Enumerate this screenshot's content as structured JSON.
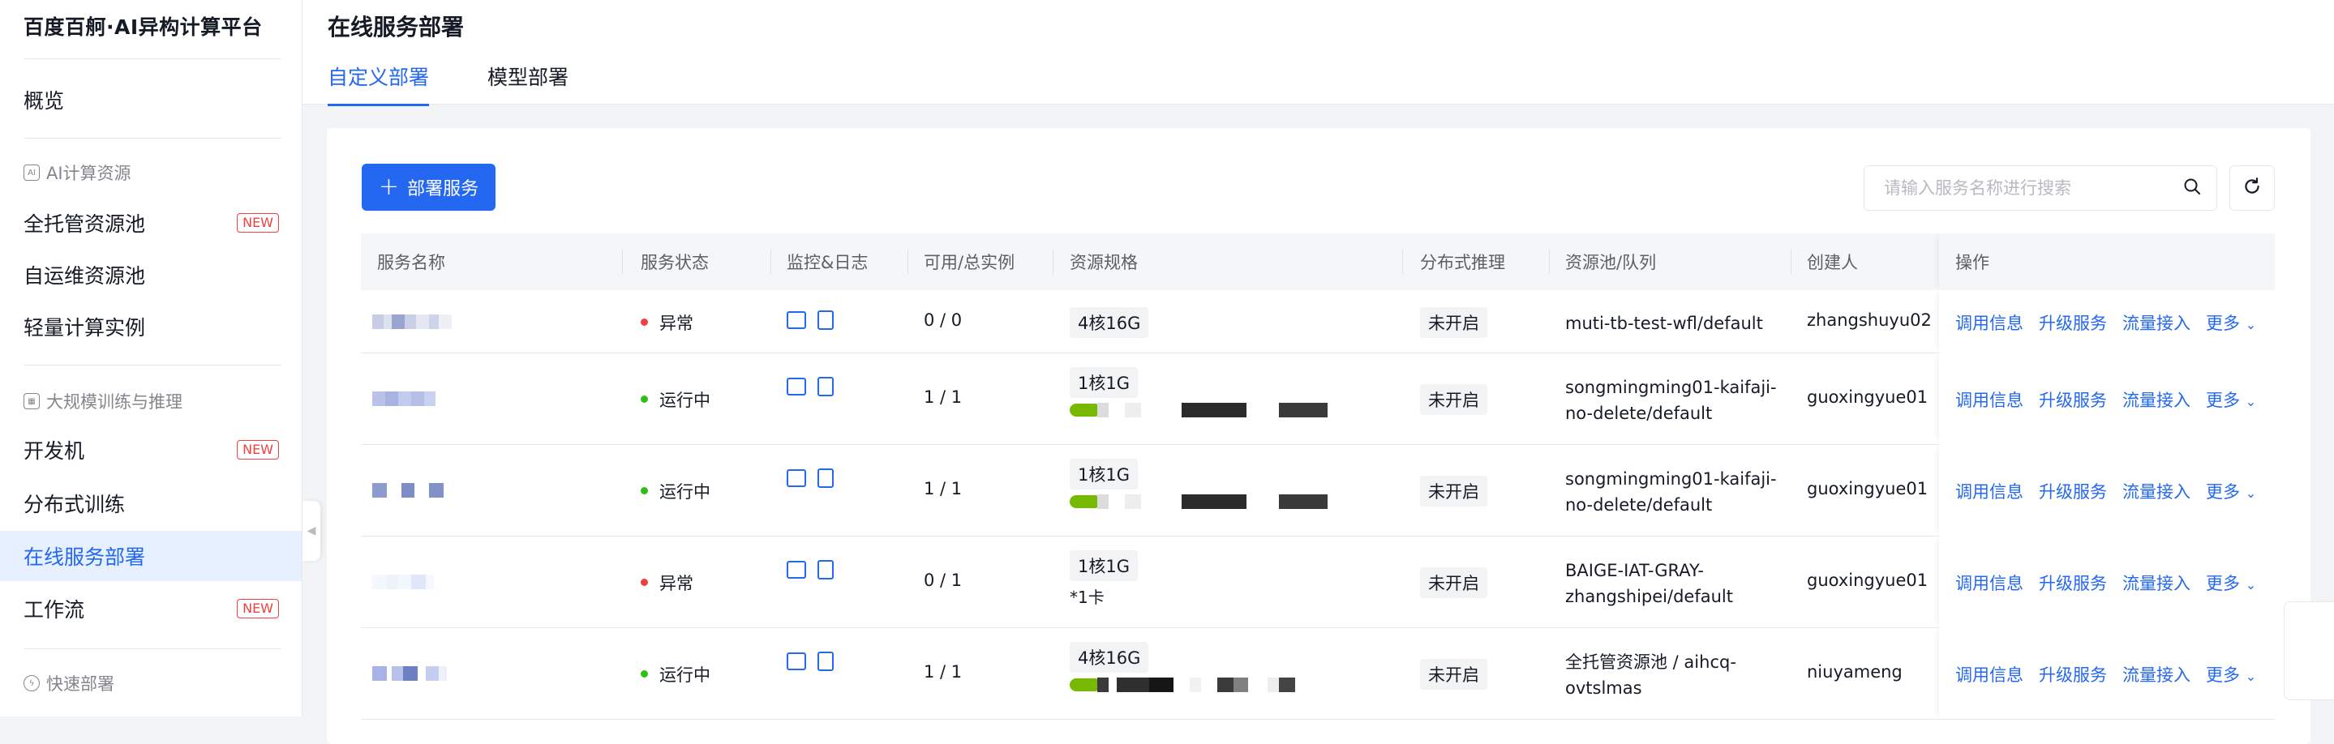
{
  "sidebar": {
    "brand": "百度百舸·AI异构计算平台",
    "overview": "概览",
    "group_ai": "AI计算资源",
    "items_ai": [
      {
        "label": "全托管资源池",
        "badge": "NEW"
      },
      {
        "label": "自运维资源池",
        "badge": ""
      },
      {
        "label": "轻量计算实例",
        "badge": ""
      }
    ],
    "group_train": "大规模训练与推理",
    "items_train": [
      {
        "label": "开发机",
        "badge": "NEW"
      },
      {
        "label": "分布式训练",
        "badge": ""
      },
      {
        "label": "在线服务部署",
        "badge": ""
      },
      {
        "label": "工作流",
        "badge": "NEW"
      }
    ],
    "group_quick": "快速部署"
  },
  "header": {
    "title": "在线服务部署",
    "tabs": [
      {
        "label": "自定义部署"
      },
      {
        "label": "模型部署"
      }
    ]
  },
  "toolbar": {
    "deploy_button": "部署服务",
    "search_placeholder": "请输入服务名称进行搜索"
  },
  "table": {
    "columns": [
      "服务名称",
      "服务状态",
      "监控&日志",
      "可用/总实例",
      "资源规格",
      "分布式推理",
      "资源池/队列",
      "创建人",
      "操作"
    ],
    "rows": [
      {
        "status": "异常",
        "status_color": "#f33e3e",
        "instances": "0 / 0",
        "spec": "4核16G",
        "spec_extra": "",
        "gpu": false,
        "distributed": "未开启",
        "pool": "muti-tb-test-wfl/default",
        "pool_line2": "",
        "creator": "zhangshuyu02"
      },
      {
        "status": "运行中",
        "status_color": "#30bf13",
        "instances": "1 / 1",
        "spec": "1核1G",
        "spec_extra": "",
        "gpu": true,
        "distributed": "未开启",
        "pool": "songmingming01-kaifaji-",
        "pool_line2": "no-delete/default",
        "creator": "guoxingyue01"
      },
      {
        "status": "运行中",
        "status_color": "#30bf13",
        "instances": "1 / 1",
        "spec": "1核1G",
        "spec_extra": "",
        "gpu": true,
        "distributed": "未开启",
        "pool": "songmingming01-kaifaji-",
        "pool_line2": "no-delete/default",
        "creator": "guoxingyue01"
      },
      {
        "status": "异常",
        "status_color": "#f33e3e",
        "instances": "0 / 1",
        "spec": "1核1G",
        "spec_extra": "*1卡",
        "gpu": false,
        "distributed": "未开启",
        "pool": "BAIGE-IAT-GRAY-",
        "pool_line2": "zhangshipei/default",
        "creator": "guoxingyue01"
      },
      {
        "status": "运行中",
        "status_color": "#30bf13",
        "instances": "1 / 1",
        "spec": "4核16G",
        "spec_extra": "",
        "gpu": true,
        "distributed": "未开启",
        "pool": "全托管资源池 / aihcq-",
        "pool_line2": "ovtslmas",
        "creator": "niuyameng"
      }
    ],
    "actions": [
      "调用信息",
      "升级服务",
      "流量接入",
      "更多"
    ]
  },
  "colors": {
    "accent": "#2468f2",
    "danger": "#f33e3e",
    "success": "#30bf13"
  }
}
